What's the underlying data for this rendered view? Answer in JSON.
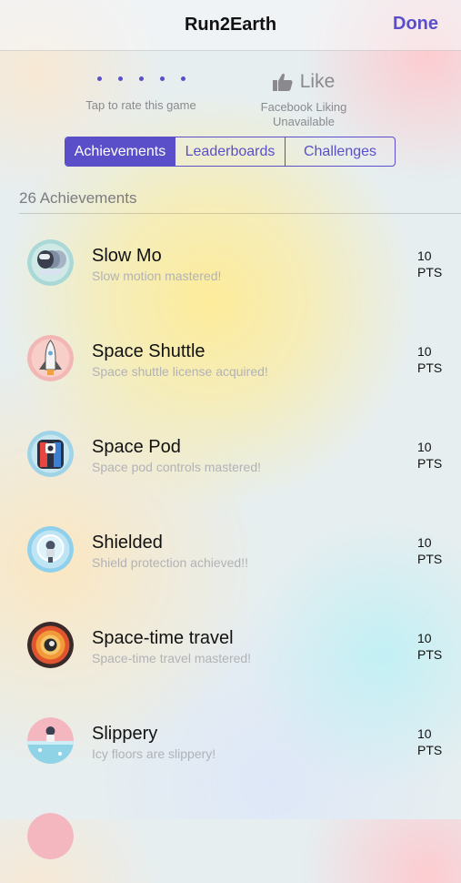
{
  "nav": {
    "title": "Run2Earth",
    "done_label": "Done"
  },
  "rating": {
    "caption": "Tap to rate this game",
    "dot_count": 5
  },
  "facebook": {
    "like_label": "Like",
    "caption_line1": "Facebook Liking",
    "caption_line2": "Unavailable",
    "icon": "thumbs-up-icon"
  },
  "tabs": [
    {
      "label": "Achievements",
      "active": true
    },
    {
      "label": "Leaderboards",
      "active": false
    },
    {
      "label": "Challenges",
      "active": false
    }
  ],
  "achievements_count_label": "26 Achievements",
  "achievements": [
    {
      "title": "Slow Mo",
      "description": "Slow motion mastered!",
      "points": "10",
      "points_unit": "PTS",
      "icon": "slow-mo-badge-icon"
    },
    {
      "title": "Space Shuttle",
      "description": "Space shuttle license acquired!",
      "points": "10",
      "points_unit": "PTS",
      "icon": "space-shuttle-badge-icon"
    },
    {
      "title": "Space Pod",
      "description": "Space pod controls mastered!",
      "points": "10",
      "points_unit": "PTS",
      "icon": "space-pod-badge-icon"
    },
    {
      "title": "Shielded",
      "description": "Shield protection achieved!!",
      "points": "10",
      "points_unit": "PTS",
      "icon": "shield-badge-icon"
    },
    {
      "title": "Space-time travel",
      "description": "Space-time travel mastered!",
      "points": "10",
      "points_unit": "PTS",
      "icon": "space-time-badge-icon"
    },
    {
      "title": "Slippery",
      "description": "Icy floors are slippery!",
      "points": "10",
      "points_unit": "PTS",
      "icon": "slippery-badge-icon"
    }
  ],
  "colors": {
    "accent": "#5a4fc8",
    "subtext": "#b2b2b6",
    "muted": "#8a8a8e"
  }
}
